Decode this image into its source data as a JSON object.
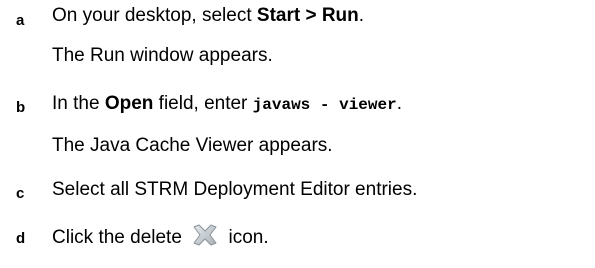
{
  "steps": [
    {
      "letter": "a",
      "line1": {
        "prefix": "On your desktop, select ",
        "bold": "Start > Run",
        "suffix": "."
      },
      "result": "The Run window appears."
    },
    {
      "letter": "b",
      "line1": {
        "prefix": "In the ",
        "bold": "Open",
        "middle": " field, enter ",
        "code": "javaws - viewer",
        "suffix": "."
      },
      "result": "The Java Cache Viewer appears."
    },
    {
      "letter": "c",
      "text": "Select all STRM Deployment Editor entries."
    },
    {
      "letter": "d",
      "prefix": "Click the delete ",
      "icon": "delete-x-icon",
      "suffix": " icon."
    }
  ],
  "colors": {
    "text": "#000000",
    "icon_fill": "#c0c8cc",
    "icon_stroke": "#8a9298"
  }
}
